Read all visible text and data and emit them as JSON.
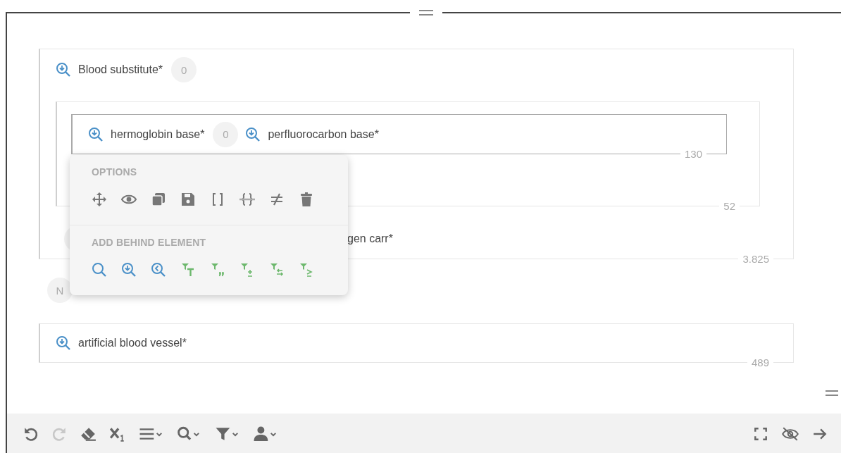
{
  "group": {
    "label": "Blood substitute*",
    "badge": "0",
    "total": "3.825",
    "subgroup": {
      "total": "52",
      "box": {
        "total": "130",
        "terms": [
          {
            "label": "hermoglobin base*",
            "badge": "0"
          },
          {
            "label": "perfluorocarbon base*"
          }
        ]
      }
    },
    "partial_row": {
      "text": "gen carr*"
    }
  },
  "connector_badge": "N",
  "group2": {
    "label": "artificial blood vessel*",
    "total": "489"
  },
  "popup": {
    "sections": [
      {
        "heading": "OPTIONS",
        "kind": "options"
      },
      {
        "heading": "ADD BEHIND ELEMENT",
        "kind": "add"
      }
    ]
  },
  "toolbar": {
    "left": [
      {
        "kind": "undo",
        "disabled": false
      },
      {
        "kind": "redo",
        "disabled": true
      },
      {
        "kind": "eraser",
        "disabled": false
      },
      {
        "kind": "subscript",
        "disabled": false
      },
      {
        "kind": "list",
        "disabled": false
      },
      {
        "kind": "search",
        "disabled": false
      },
      {
        "kind": "filter",
        "disabled": false
      },
      {
        "kind": "user",
        "disabled": false
      }
    ],
    "right": [
      {
        "kind": "fullscreen",
        "disabled": false
      },
      {
        "kind": "hide",
        "disabled": false
      },
      {
        "kind": "next",
        "disabled": false
      }
    ]
  }
}
